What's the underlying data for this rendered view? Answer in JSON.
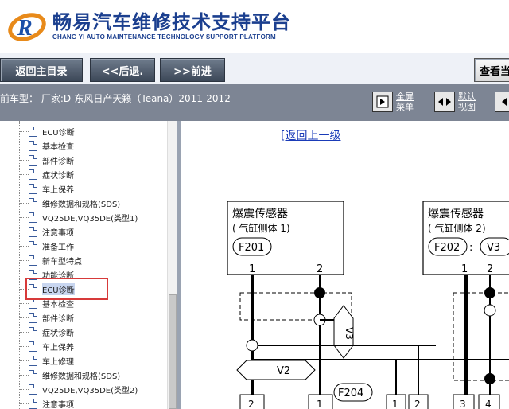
{
  "header": {
    "brand_title": "畅易汽车维修技术支持平台",
    "brand_subtitle": "CHANG YI AUTO MAINTENANCE TECHNOLOGY SUPPORT PLATFORM",
    "logo_letter": "R"
  },
  "toolbar": {
    "home_label": "返回主目录",
    "back_label": "<<后退.",
    "forward_label": ">>前进",
    "view_label": "查看当"
  },
  "infobar": {
    "model_text": "前车型： 厂家:D-东风日产天籁（Teana）2011-2012",
    "fullscreen_label": "全屏菜单",
    "default_view_label": "默认视图"
  },
  "sidebar": {
    "items": [
      {
        "label": "ECU诊断"
      },
      {
        "label": "基本检查"
      },
      {
        "label": "部件诊断"
      },
      {
        "label": "症状诊断"
      },
      {
        "label": "车上保养"
      },
      {
        "label": "维修数据和规格(SDS)"
      },
      {
        "label": "VQ25DE,VQ35DE(类型1)"
      },
      {
        "label": "注意事项"
      },
      {
        "label": "准备工作"
      },
      {
        "label": "新车型特点"
      },
      {
        "label": "功能诊断"
      },
      {
        "label": "ECU诊断"
      },
      {
        "label": "基本检查"
      },
      {
        "label": "部件诊断"
      },
      {
        "label": "症状诊断"
      },
      {
        "label": "车上保养"
      },
      {
        "label": "车上修理"
      },
      {
        "label": "维修数据和规格(SDS)"
      },
      {
        "label": "VQ25DE,VQ35DE(类型2)"
      },
      {
        "label": "注意事项"
      }
    ],
    "selected_index": 11
  },
  "content": {
    "back_link_prefix": "[",
    "back_link_text": "返回上一级",
    "diagram": {
      "sensor1_title": "爆震传感器",
      "sensor1_sub": "( 气缸侧体 1)",
      "sensor1_conn": "F201",
      "sensor2_title": "爆震传感器",
      "sensor2_sub": "( 气缸侧体 2)",
      "sensor2_conn": "F202",
      "sensor2_tag": "V3",
      "pin1": "1",
      "pin2": "2",
      "v3_label": "V3",
      "v2_label": "V2",
      "conn_f204": "F204",
      "bottom_pins": [
        "2",
        "1",
        "1",
        "2",
        "3",
        "4"
      ]
    }
  }
}
